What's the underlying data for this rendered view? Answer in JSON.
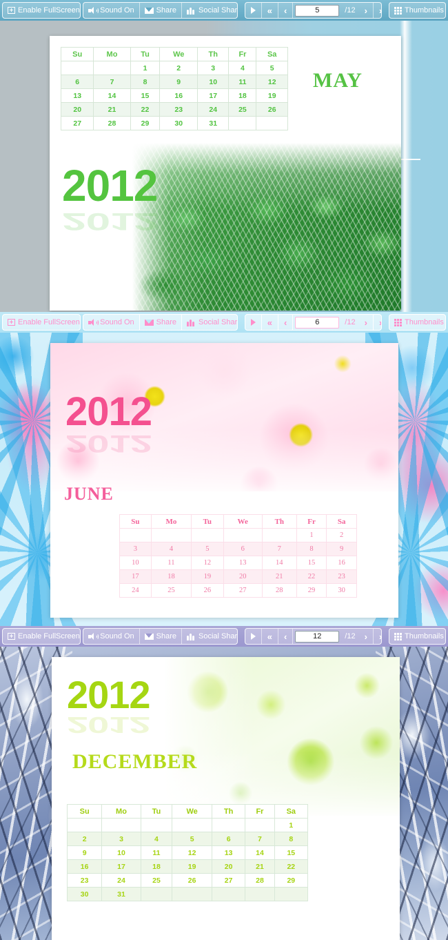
{
  "toolbars": [
    {
      "theme": "blue",
      "fullscreen_label": "Enable FullScreen",
      "sound_label": "Sound On",
      "share_label": "Share",
      "social_share_label": "Social Share",
      "page_value": "5",
      "page_total": "/12",
      "thumbnails_label": "Thumbnails",
      "accent": "#5ea6c2"
    },
    {
      "theme": "pink",
      "fullscreen_label": "Enable FullScreen",
      "sound_label": "Sound On",
      "share_label": "Share",
      "social_share_label": "Social Share",
      "page_value": "6",
      "page_total": "/12",
      "thumbnails_label": "Thumbnails",
      "accent": "#ff8ecb"
    },
    {
      "theme": "purple",
      "fullscreen_label": "Enable FullScreen",
      "sound_label": "Sound On",
      "share_label": "Share",
      "social_share_label": "Social Share",
      "page_value": "12",
      "page_total": "/12",
      "thumbnails_label": "Thumbnails",
      "accent": "#9b97cf"
    }
  ],
  "weekdays": [
    "Su",
    "Mo",
    "Tu",
    "We",
    "Th",
    "Fr",
    "Sa"
  ],
  "pages": [
    {
      "id": "may",
      "month": "MAY",
      "year": "2012",
      "accent": "#54c43f",
      "background": "grey-blue gradient",
      "photo": "green fittonia leaves",
      "weeks": [
        [
          "",
          "",
          "1",
          "2",
          "3",
          "4",
          "5"
        ],
        [
          "6",
          "7",
          "8",
          "9",
          "10",
          "11",
          "12"
        ],
        [
          "13",
          "14",
          "15",
          "16",
          "17",
          "18",
          "19"
        ],
        [
          "20",
          "21",
          "22",
          "23",
          "24",
          "25",
          "26"
        ],
        [
          "27",
          "28",
          "29",
          "30",
          "31",
          "",
          ""
        ]
      ]
    },
    {
      "id": "june",
      "month": "JUNE",
      "year": "2012",
      "accent": "#f4508f",
      "background": "blue and pink fractal",
      "photo": "pink chrysanthemum flowers",
      "weeks": [
        [
          "",
          "",
          "",
          "",
          "",
          "1",
          "2"
        ],
        [
          "3",
          "4",
          "5",
          "6",
          "7",
          "8",
          "9"
        ],
        [
          "10",
          "11",
          "12",
          "13",
          "14",
          "15",
          "16"
        ],
        [
          "17",
          "18",
          "19",
          "20",
          "21",
          "22",
          "23"
        ],
        [
          "24",
          "25",
          "26",
          "27",
          "28",
          "29",
          "30"
        ]
      ]
    },
    {
      "id": "december",
      "month": "DECEMBER",
      "year": "2012",
      "accent": "#a5d612",
      "background": "snow covered branches",
      "photo": "green chrysanthemum bouquet",
      "weeks": [
        [
          "",
          "",
          "",
          "",
          "",
          "",
          "1"
        ],
        [
          "2",
          "3",
          "4",
          "5",
          "6",
          "7",
          "8"
        ],
        [
          "9",
          "10",
          "11",
          "12",
          "13",
          "14",
          "15"
        ],
        [
          "16",
          "17",
          "18",
          "19",
          "20",
          "21",
          "22"
        ],
        [
          "23",
          "24",
          "25",
          "26",
          "27",
          "28",
          "29"
        ],
        [
          "30",
          "31",
          "",
          "",
          "",
          "",
          ""
        ]
      ]
    }
  ],
  "icons": {
    "fullscreen": "fullscreen-icon",
    "sound": "speaker-icon",
    "share": "envelope-icon",
    "social": "people-icon",
    "play": "play-icon",
    "first": "double-chevron-left-icon",
    "prev": "chevron-left-icon",
    "next": "chevron-right-icon",
    "last": "double-chevron-right-icon",
    "thumbnails": "grid-icon"
  }
}
